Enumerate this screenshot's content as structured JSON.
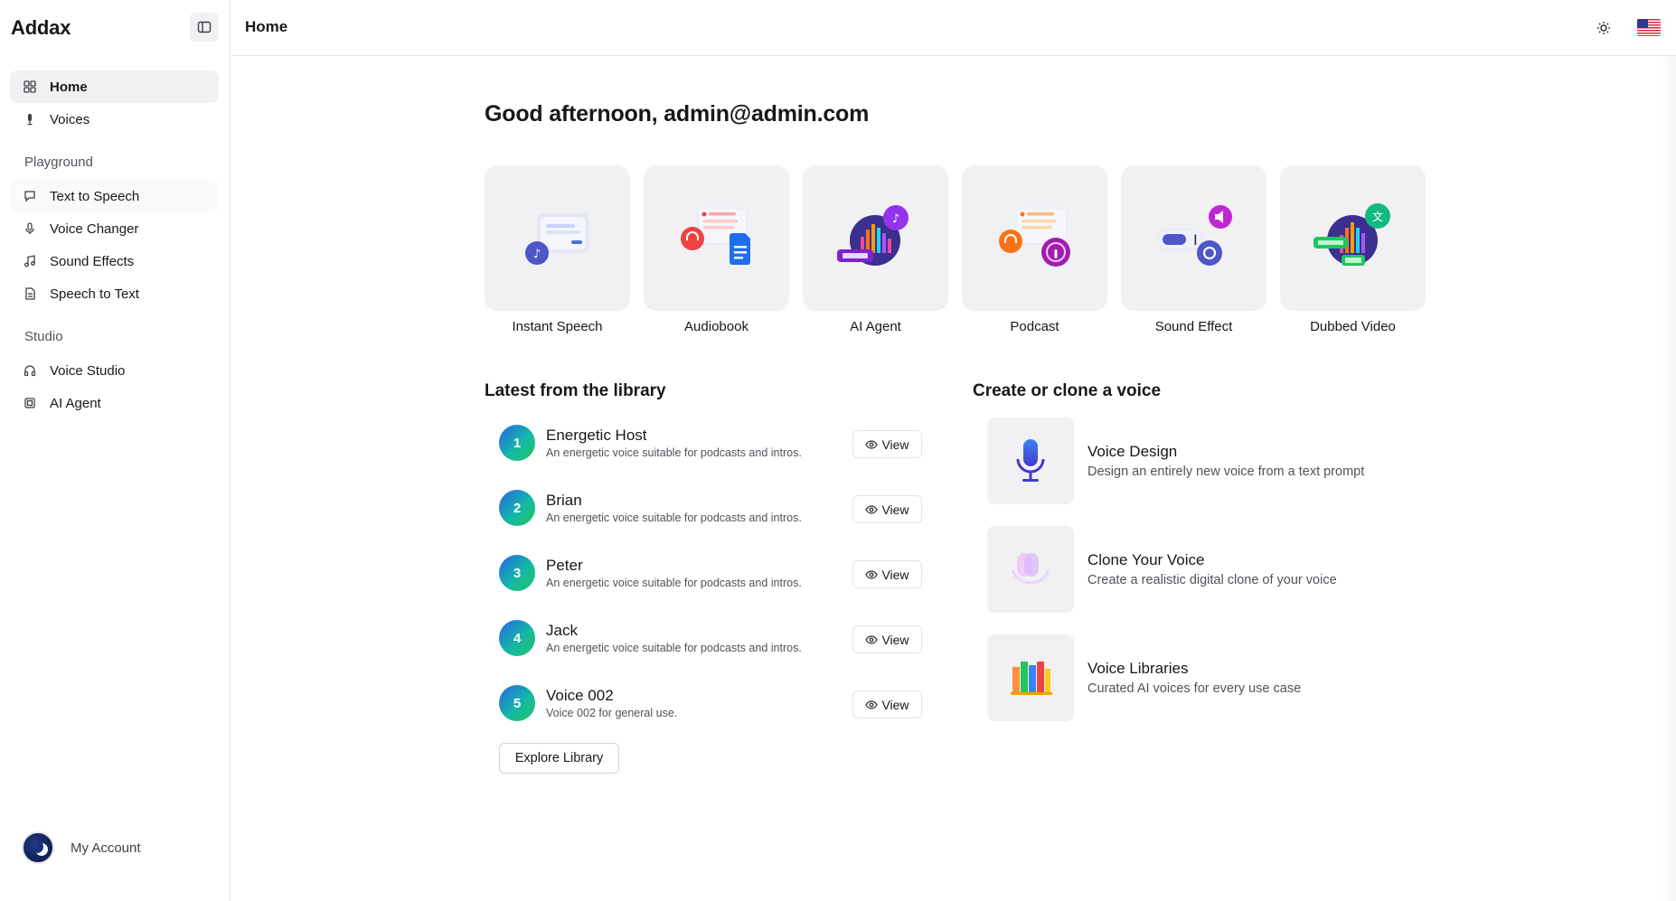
{
  "app": {
    "name": "Addax"
  },
  "header": {
    "title": "Home"
  },
  "sidebar": {
    "items": [
      {
        "label": "Home",
        "icon": "grid-icon"
      },
      {
        "label": "Voices",
        "icon": "mic-icon"
      }
    ],
    "groups": [
      {
        "label": "Playground",
        "items": [
          {
            "label": "Text to Speech",
            "icon": "message-icon"
          },
          {
            "label": "Voice Changer",
            "icon": "mic-icon"
          },
          {
            "label": "Sound Effects",
            "icon": "music-icon"
          },
          {
            "label": "Speech to Text",
            "icon": "document-icon"
          }
        ]
      },
      {
        "label": "Studio",
        "items": [
          {
            "label": "Voice Studio",
            "icon": "headphones-icon"
          },
          {
            "label": "AI Agent",
            "icon": "chip-icon"
          }
        ]
      }
    ],
    "account": {
      "label": "My Account"
    }
  },
  "main": {
    "greeting": "Good afternoon, admin@admin.com",
    "tiles": [
      {
        "label": "Instant Speech",
        "icon": "instant-speech-illustration"
      },
      {
        "label": "Audiobook",
        "icon": "audiobook-illustration"
      },
      {
        "label": "AI Agent",
        "icon": "ai-agent-illustration"
      },
      {
        "label": "Podcast",
        "icon": "podcast-illustration"
      },
      {
        "label": "Sound Effect",
        "icon": "sound-effect-illustration"
      },
      {
        "label": "Dubbed Video",
        "icon": "dubbed-video-illustration"
      }
    ],
    "library": {
      "title": "Latest from the library",
      "view_label": "View",
      "items": [
        {
          "num": "1",
          "name": "Energetic Host",
          "desc": "An energetic voice suitable for podcasts and intros."
        },
        {
          "num": "2",
          "name": "Brian",
          "desc": "An energetic voice suitable for podcasts and intros."
        },
        {
          "num": "3",
          "name": "Peter",
          "desc": "An energetic voice suitable for podcasts and intros."
        },
        {
          "num": "4",
          "name": "Jack",
          "desc": "An energetic voice suitable for podcasts and intros."
        },
        {
          "num": "5",
          "name": "Voice 002",
          "desc": "Voice 002 for general use."
        }
      ],
      "explore_label": "Explore Library"
    },
    "clone": {
      "title": "Create or clone a voice",
      "items": [
        {
          "title": "Voice Design",
          "desc": "Design an entirely new voice from a text prompt",
          "icon": "microphone-icon"
        },
        {
          "title": "Clone Your Voice",
          "desc": "Create a realistic digital clone of your voice",
          "icon": "mic-clone-icon"
        },
        {
          "title": "Voice Libraries",
          "desc": "Curated AI voices for every use case",
          "icon": "books-icon"
        }
      ]
    }
  },
  "colors": {
    "accent_gradient_start": "#2563eb",
    "accent_gradient_end": "#22c55e",
    "tile_bg": "#f1f1f3"
  }
}
